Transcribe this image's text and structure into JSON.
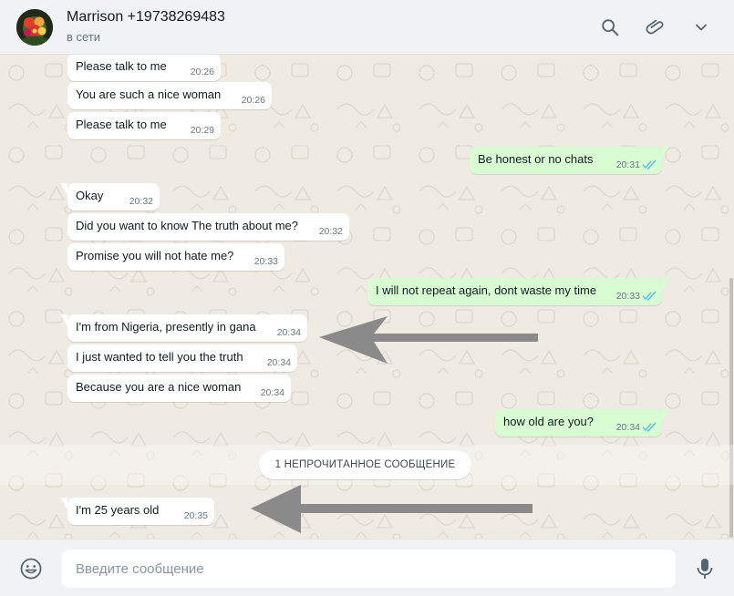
{
  "header": {
    "contact_name": "Marrison +19738269483",
    "status": "в сети",
    "icons": [
      "search-icon",
      "paperclip-icon",
      "chevron-down-icon"
    ]
  },
  "colors": {
    "incoming_bubble": "#ffffff",
    "outgoing_bubble": "#d9fdd3",
    "read_ticks": "#53bdeb",
    "chat_background": "#efeae2",
    "annotation_arrow": "#8a8a8a"
  },
  "messages": [
    {
      "direction": "in",
      "text": "Please talk to me",
      "time": "20:26"
    },
    {
      "direction": "in",
      "text": "You are such a nice woman",
      "time": "20:26"
    },
    {
      "direction": "in",
      "text": "Please talk to me",
      "time": "20:29"
    },
    {
      "direction": "out",
      "text": "Be honest or no chats",
      "time": "20:31",
      "status": "read"
    },
    {
      "direction": "in",
      "text": "Okay",
      "time": "20:32"
    },
    {
      "direction": "in",
      "text": "Did you want to know The truth about me?",
      "time": "20:32"
    },
    {
      "direction": "in",
      "text": "Promise you will not hate me?",
      "time": "20:33"
    },
    {
      "direction": "out",
      "text": "I will not repeat again, dont waste my time",
      "time": "20:33",
      "status": "read"
    },
    {
      "direction": "in",
      "text": "I'm from Nigeria, presently in gana",
      "time": "20:34"
    },
    {
      "direction": "in",
      "text": "I just wanted to tell you the truth",
      "time": "20:34"
    },
    {
      "direction": "in",
      "text": "Because you are a nice woman",
      "time": "20:34"
    },
    {
      "direction": "out",
      "text": "how old are you?",
      "time": "20:34",
      "status": "read"
    },
    {
      "direction": "in",
      "text": "I'm 25 years old",
      "time": "20:35"
    }
  ],
  "unread_divider": "1 НЕПРОЧИТАННОЕ СООБЩЕНИЕ",
  "composer": {
    "placeholder": "Введите сообщение",
    "value": "",
    "icons": [
      "emoji-icon",
      "microphone-icon"
    ]
  }
}
